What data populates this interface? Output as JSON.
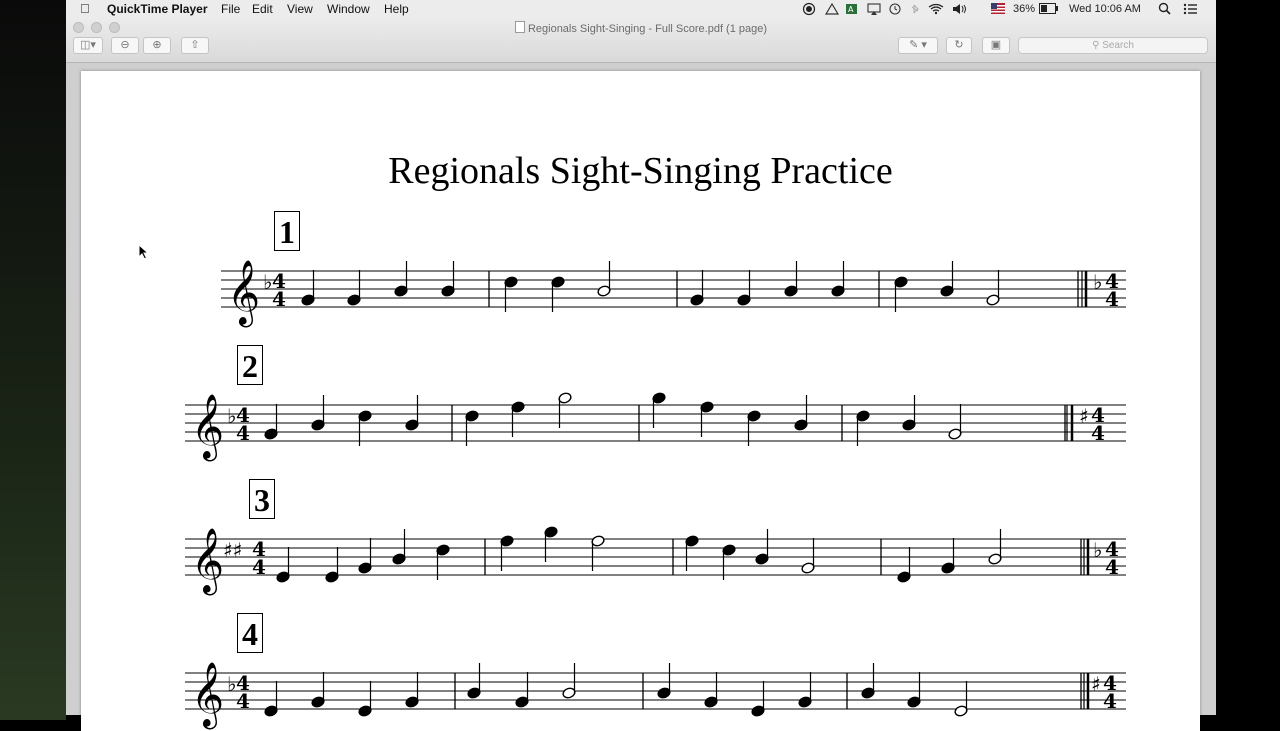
{
  "menubar": {
    "app_name": "QuickTime Player",
    "menus": [
      "File",
      "Edit",
      "View",
      "Window",
      "Help"
    ],
    "battery": "36%",
    "clock": "Wed 10:06 AM"
  },
  "window": {
    "title": "Regionals Sight-Singing - Full Score.pdf (1 page)",
    "search_placeholder": "Search"
  },
  "score": {
    "title": "Regionals Sight-Singing Practice",
    "exercises": [
      {
        "number": "1",
        "key": "F major (1 flat)",
        "time": "4/4"
      },
      {
        "number": "2",
        "key": "F major (1 flat)",
        "time": "4/4"
      },
      {
        "number": "3",
        "key": "D major (2 sharps)",
        "time": "4/4"
      },
      {
        "number": "4",
        "key": "F major (1 flat)",
        "time": "4/4"
      }
    ]
  }
}
